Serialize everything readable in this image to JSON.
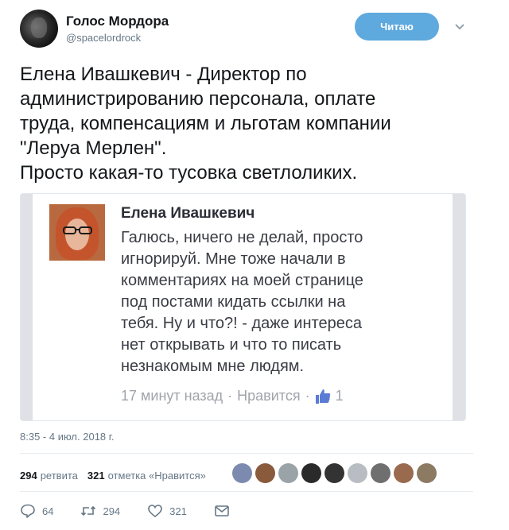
{
  "header": {
    "name": "Голос Мордора",
    "handle": "@spacelordrock",
    "follow_label": "Читаю",
    "avatar_icon": "profile-avatar",
    "caret_icon": "chevron-down-icon"
  },
  "tweet": {
    "text": "Елена Ивашкевич - Директор по\nадминистрированию персонала, оплате\nтруда, компенсациям и льготам компании\n\"Леруа Мерлен\".\nПросто какая-то тусовка светлоликих."
  },
  "embedded_post": {
    "author": "Елена Ивашкевич",
    "body": "Галюсь, ничего не делай, просто\nигнорируй. Мне тоже начали в\nкомментариях на моей странице\nпод постами кидать ссылки на\nтебя. Ну и что?! - даже интереса\nнет открывать и что то писать\nнезнакомым мне людям.",
    "time": "17 минут назад",
    "sep": "·",
    "like_label": "Нравится",
    "like_count": "1"
  },
  "timestamp": "8:35 - 4 июл. 2018 г.",
  "stats": {
    "retweets_count": "294",
    "retweets_label": "ретвита",
    "likes_count": "321",
    "likes_label": "отметка «Нравится»",
    "liker_colors": [
      "#7d8ab0",
      "#8a5a3c",
      "#9aa3a8",
      "#2a2a2a",
      "#333333",
      "#b7bdc2",
      "#6f6f6f",
      "#9a6a4f",
      "#8c7a62"
    ]
  },
  "actions": {
    "reply_count": "64",
    "retweet_count": "294",
    "like_count": "321"
  },
  "colors": {
    "accent": "#5ea9dd",
    "muted": "#657786"
  }
}
